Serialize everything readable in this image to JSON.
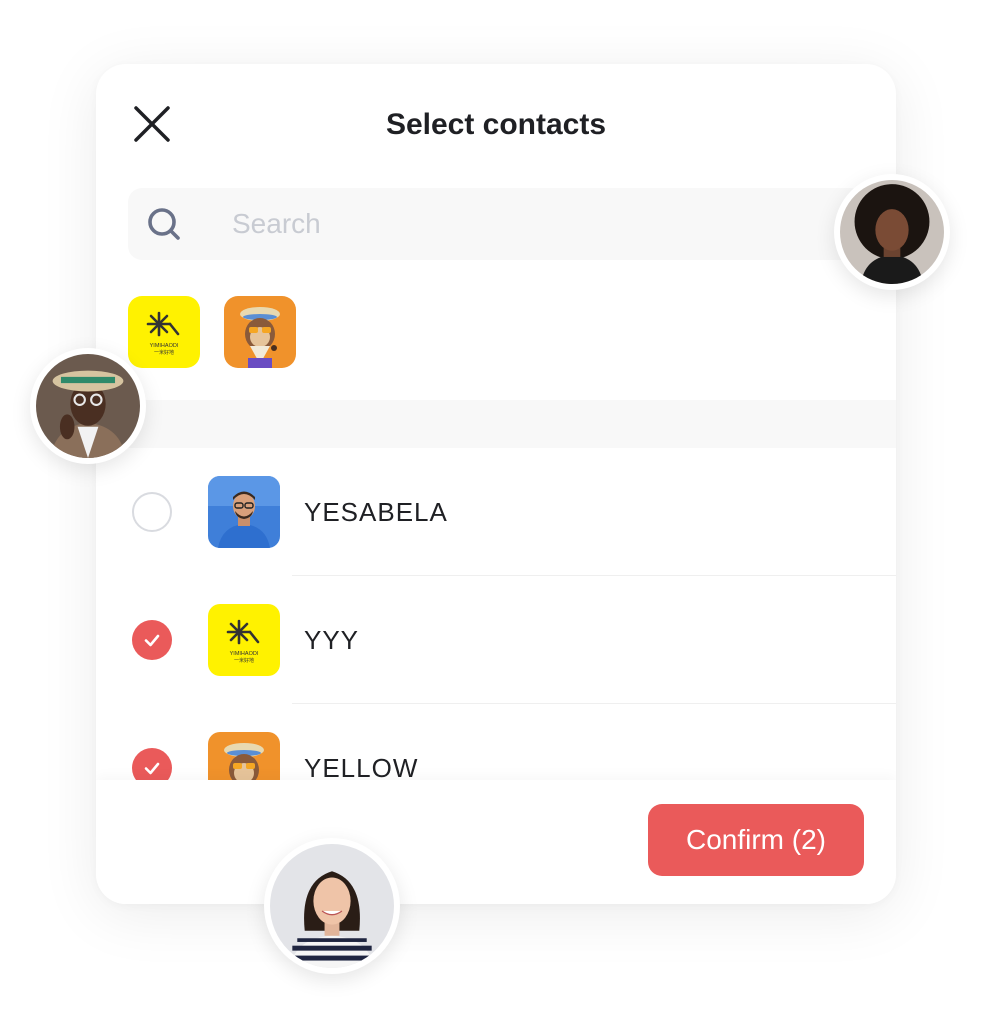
{
  "header": {
    "title": "Select contacts",
    "close_icon": "close-icon"
  },
  "search": {
    "placeholder": "Search",
    "value": "",
    "icon": "search-icon"
  },
  "selected": [
    {
      "avatar": "yimihaodi-logo",
      "logo_text": "YIMIHAODI",
      "logo_sub": "一米好地"
    },
    {
      "avatar": "ape-nft-avatar"
    }
  ],
  "contacts": [
    {
      "name": "YESABELA",
      "checked": false,
      "avatar": "man-glasses-photo"
    },
    {
      "name": "YYY",
      "checked": true,
      "avatar": "yimihaodi-logo"
    },
    {
      "name": "YELLOW",
      "checked": true,
      "avatar": "ape-nft-avatar"
    }
  ],
  "footer": {
    "confirm_label": "Confirm (2)"
  },
  "colors": {
    "accent": "#ea5a5a",
    "logo_yellow": "#fff200",
    "ape_orange": "#f0922b",
    "search_bg": "#f8f8f8"
  }
}
